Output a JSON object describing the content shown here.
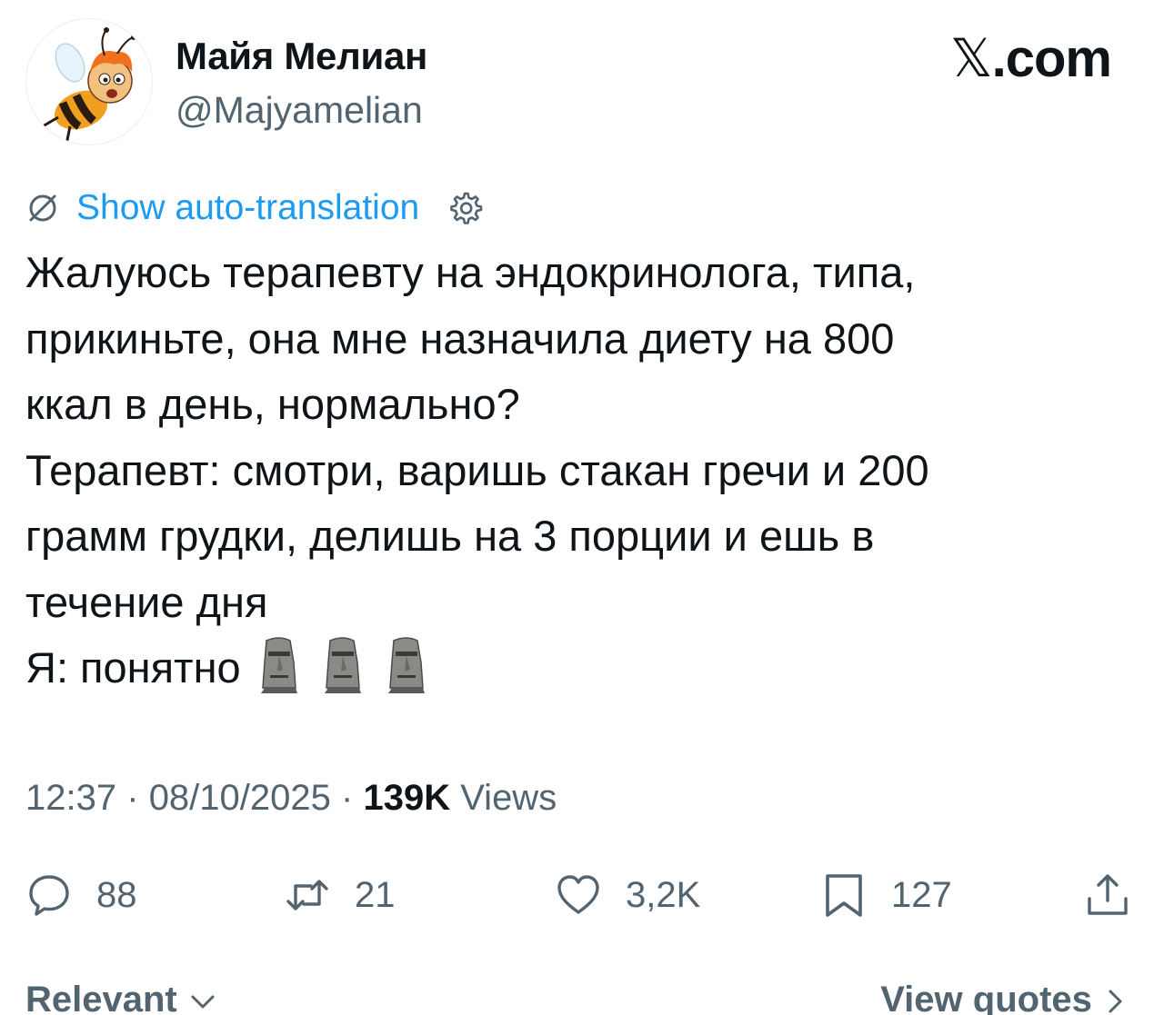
{
  "author": {
    "display_name": "Майя Мелиан",
    "handle": "@Majyamelian",
    "avatar_icon": "bee-cartoon-avatar"
  },
  "brand": {
    "label": "com",
    "glyph": "𝕏",
    "dot": "."
  },
  "translation": {
    "link_label": "Show auto-translation",
    "icon": "globe-slash-icon",
    "settings_icon": "gear-icon",
    "link_color": "#1d9bf0"
  },
  "tweet": {
    "lines": [
      "Жалуюсь терапевту на эндокринолога, типа,",
      "прикиньте, она мне назначила диету на 800",
      "ккал в день, нормально?",
      "Терапевт: смотри, варишь стакан гречи и 200",
      "грамм грудки, делишь на 3 порции и ешь в",
      "течение дня",
      "Я: понятно"
    ],
    "emoji": [
      "moai",
      "moai",
      "moai"
    ]
  },
  "meta": {
    "time": "12:37",
    "date": "08/10/2025",
    "separator": "·",
    "views_count": "139K",
    "views_label": "Views"
  },
  "actions": {
    "replies": "88",
    "reposts": "21",
    "likes": "3,2K",
    "bookmarks": "127"
  },
  "footer": {
    "sort_label": "Relevant",
    "quotes_label": "View quotes"
  }
}
